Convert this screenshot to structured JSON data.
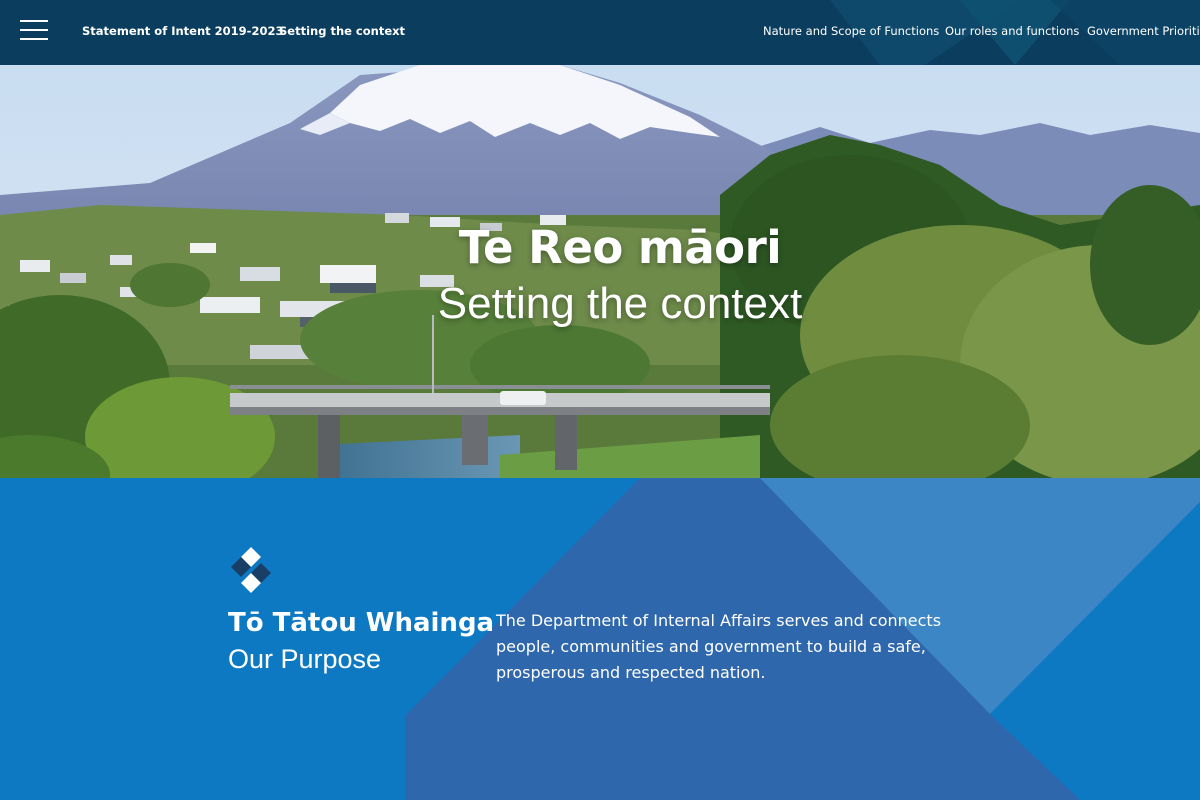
{
  "header": {
    "menu_icon": "hamburger-menu-icon",
    "breadcrumbs": [
      "Statement of Intent 2019-2023",
      "Setting the context"
    ],
    "nav": [
      "Nature and Scope of Functions",
      "Our roles and functions",
      "Government Priorities"
    ]
  },
  "hero": {
    "title": "Te Reo māori",
    "subtitle": "Setting the context"
  },
  "purpose": {
    "logo_icon": "dia-logo-icon",
    "heading": "Tō Tātou Whainga",
    "subheading": "Our Purpose",
    "text": "The Department of Internal Affairs serves and connects people, communities and government to build a safe, prosperous and respected nation."
  },
  "colors": {
    "topbar": "#0b3e5e",
    "purpose_bg": "#0e79c3",
    "purpose_shape_dark": "#2f67ad",
    "purpose_shape_light": "#3d86c6",
    "text": "#ffffff"
  }
}
